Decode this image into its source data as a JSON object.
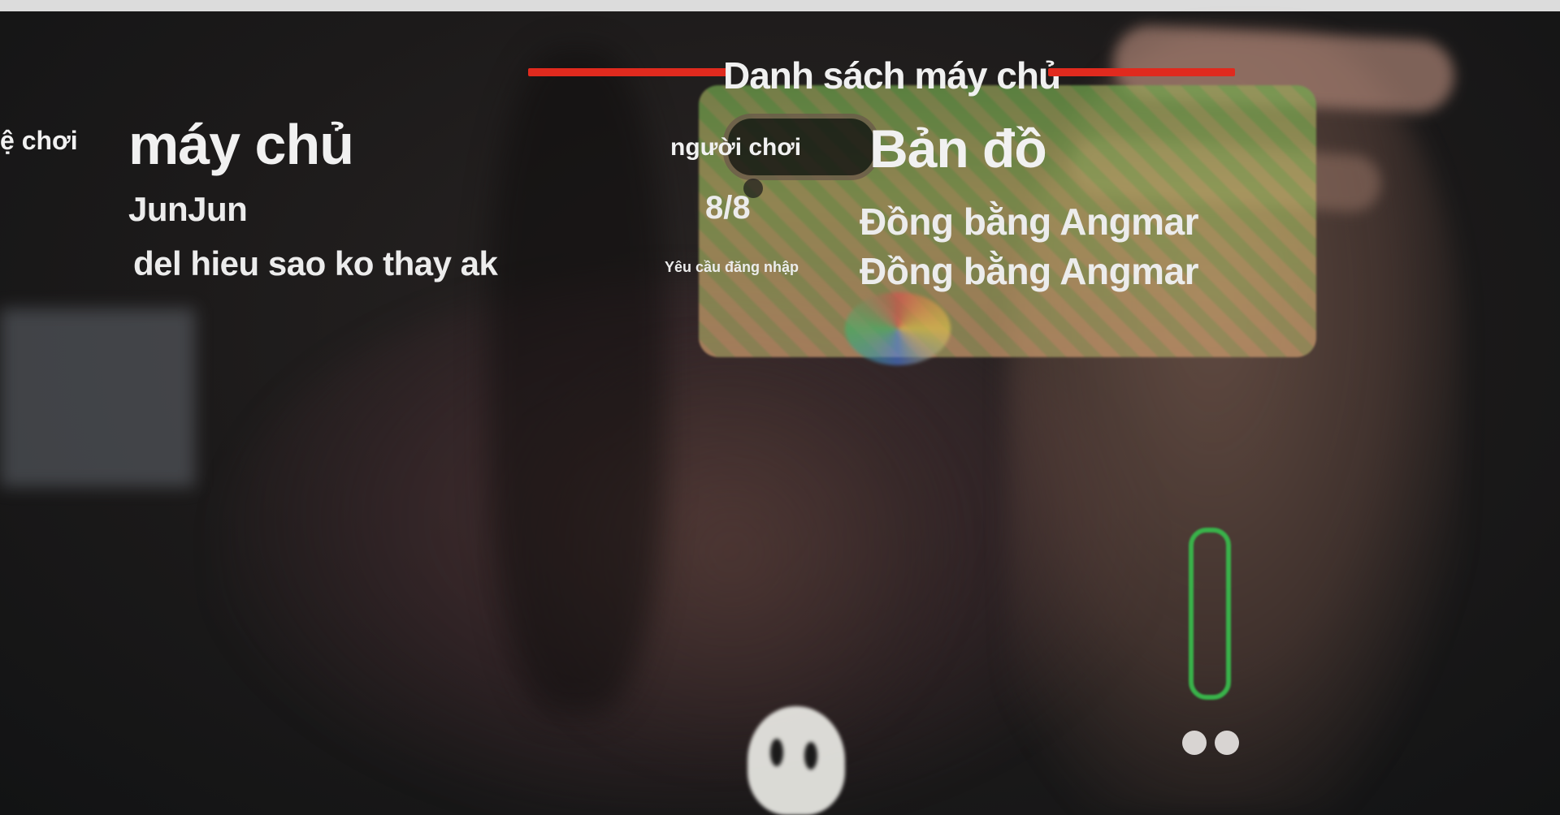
{
  "header": {
    "title": "Danh sách máy chủ",
    "accent_color": "#e02a1e"
  },
  "columns": {
    "partial_label": "ệ chơi",
    "server": "máy chủ",
    "players": "người chơi",
    "map": "Bản đồ"
  },
  "servers": [
    {
      "name": "JunJun",
      "players": "8/8",
      "map": "Đồng bằng Angmar"
    },
    {
      "name": "del hieu sao ko thay ak",
      "players": "Yêu cầu đăng nhập",
      "map": "Đồng bằng Angmar"
    }
  ]
}
